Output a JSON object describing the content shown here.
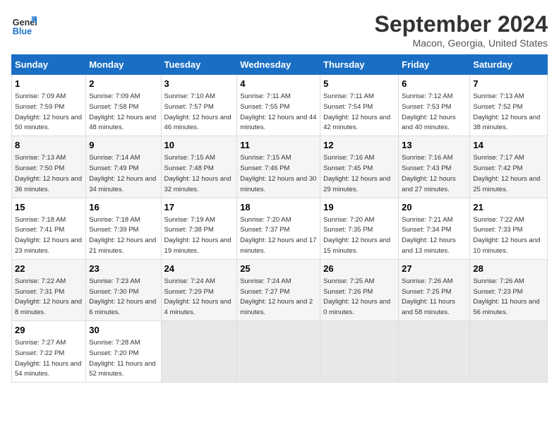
{
  "logo": {
    "line1": "General",
    "line2": "Blue"
  },
  "title": "September 2024",
  "subtitle": "Macon, Georgia, United States",
  "days_of_week": [
    "Sunday",
    "Monday",
    "Tuesday",
    "Wednesday",
    "Thursday",
    "Friday",
    "Saturday"
  ],
  "weeks": [
    [
      {
        "day": "1",
        "sunrise": "Sunrise: 7:09 AM",
        "sunset": "Sunset: 7:59 PM",
        "daylight": "Daylight: 12 hours and 50 minutes."
      },
      {
        "day": "2",
        "sunrise": "Sunrise: 7:09 AM",
        "sunset": "Sunset: 7:58 PM",
        "daylight": "Daylight: 12 hours and 48 minutes."
      },
      {
        "day": "3",
        "sunrise": "Sunrise: 7:10 AM",
        "sunset": "Sunset: 7:57 PM",
        "daylight": "Daylight: 12 hours and 46 minutes."
      },
      {
        "day": "4",
        "sunrise": "Sunrise: 7:11 AM",
        "sunset": "Sunset: 7:55 PM",
        "daylight": "Daylight: 12 hours and 44 minutes."
      },
      {
        "day": "5",
        "sunrise": "Sunrise: 7:11 AM",
        "sunset": "Sunset: 7:54 PM",
        "daylight": "Daylight: 12 hours and 42 minutes."
      },
      {
        "day": "6",
        "sunrise": "Sunrise: 7:12 AM",
        "sunset": "Sunset: 7:53 PM",
        "daylight": "Daylight: 12 hours and 40 minutes."
      },
      {
        "day": "7",
        "sunrise": "Sunrise: 7:13 AM",
        "sunset": "Sunset: 7:52 PM",
        "daylight": "Daylight: 12 hours and 38 minutes."
      }
    ],
    [
      {
        "day": "8",
        "sunrise": "Sunrise: 7:13 AM",
        "sunset": "Sunset: 7:50 PM",
        "daylight": "Daylight: 12 hours and 36 minutes."
      },
      {
        "day": "9",
        "sunrise": "Sunrise: 7:14 AM",
        "sunset": "Sunset: 7:49 PM",
        "daylight": "Daylight: 12 hours and 34 minutes."
      },
      {
        "day": "10",
        "sunrise": "Sunrise: 7:15 AM",
        "sunset": "Sunset: 7:48 PM",
        "daylight": "Daylight: 12 hours and 32 minutes."
      },
      {
        "day": "11",
        "sunrise": "Sunrise: 7:15 AM",
        "sunset": "Sunset: 7:46 PM",
        "daylight": "Daylight: 12 hours and 30 minutes."
      },
      {
        "day": "12",
        "sunrise": "Sunrise: 7:16 AM",
        "sunset": "Sunset: 7:45 PM",
        "daylight": "Daylight: 12 hours and 29 minutes."
      },
      {
        "day": "13",
        "sunrise": "Sunrise: 7:16 AM",
        "sunset": "Sunset: 7:43 PM",
        "daylight": "Daylight: 12 hours and 27 minutes."
      },
      {
        "day": "14",
        "sunrise": "Sunrise: 7:17 AM",
        "sunset": "Sunset: 7:42 PM",
        "daylight": "Daylight: 12 hours and 25 minutes."
      }
    ],
    [
      {
        "day": "15",
        "sunrise": "Sunrise: 7:18 AM",
        "sunset": "Sunset: 7:41 PM",
        "daylight": "Daylight: 12 hours and 23 minutes."
      },
      {
        "day": "16",
        "sunrise": "Sunrise: 7:18 AM",
        "sunset": "Sunset: 7:39 PM",
        "daylight": "Daylight: 12 hours and 21 minutes."
      },
      {
        "day": "17",
        "sunrise": "Sunrise: 7:19 AM",
        "sunset": "Sunset: 7:38 PM",
        "daylight": "Daylight: 12 hours and 19 minutes."
      },
      {
        "day": "18",
        "sunrise": "Sunrise: 7:20 AM",
        "sunset": "Sunset: 7:37 PM",
        "daylight": "Daylight: 12 hours and 17 minutes."
      },
      {
        "day": "19",
        "sunrise": "Sunrise: 7:20 AM",
        "sunset": "Sunset: 7:35 PM",
        "daylight": "Daylight: 12 hours and 15 minutes."
      },
      {
        "day": "20",
        "sunrise": "Sunrise: 7:21 AM",
        "sunset": "Sunset: 7:34 PM",
        "daylight": "Daylight: 12 hours and 13 minutes."
      },
      {
        "day": "21",
        "sunrise": "Sunrise: 7:22 AM",
        "sunset": "Sunset: 7:33 PM",
        "daylight": "Daylight: 12 hours and 10 minutes."
      }
    ],
    [
      {
        "day": "22",
        "sunrise": "Sunrise: 7:22 AM",
        "sunset": "Sunset: 7:31 PM",
        "daylight": "Daylight: 12 hours and 8 minutes."
      },
      {
        "day": "23",
        "sunrise": "Sunrise: 7:23 AM",
        "sunset": "Sunset: 7:30 PM",
        "daylight": "Daylight: 12 hours and 6 minutes."
      },
      {
        "day": "24",
        "sunrise": "Sunrise: 7:24 AM",
        "sunset": "Sunset: 7:29 PM",
        "daylight": "Daylight: 12 hours and 4 minutes."
      },
      {
        "day": "25",
        "sunrise": "Sunrise: 7:24 AM",
        "sunset": "Sunset: 7:27 PM",
        "daylight": "Daylight: 12 hours and 2 minutes."
      },
      {
        "day": "26",
        "sunrise": "Sunrise: 7:25 AM",
        "sunset": "Sunset: 7:26 PM",
        "daylight": "Daylight: 12 hours and 0 minutes."
      },
      {
        "day": "27",
        "sunrise": "Sunrise: 7:26 AM",
        "sunset": "Sunset: 7:25 PM",
        "daylight": "Daylight: 11 hours and 58 minutes."
      },
      {
        "day": "28",
        "sunrise": "Sunrise: 7:26 AM",
        "sunset": "Sunset: 7:23 PM",
        "daylight": "Daylight: 11 hours and 56 minutes."
      }
    ],
    [
      {
        "day": "29",
        "sunrise": "Sunrise: 7:27 AM",
        "sunset": "Sunset: 7:22 PM",
        "daylight": "Daylight: 11 hours and 54 minutes."
      },
      {
        "day": "30",
        "sunrise": "Sunrise: 7:28 AM",
        "sunset": "Sunset: 7:20 PM",
        "daylight": "Daylight: 11 hours and 52 minutes."
      },
      null,
      null,
      null,
      null,
      null
    ]
  ]
}
